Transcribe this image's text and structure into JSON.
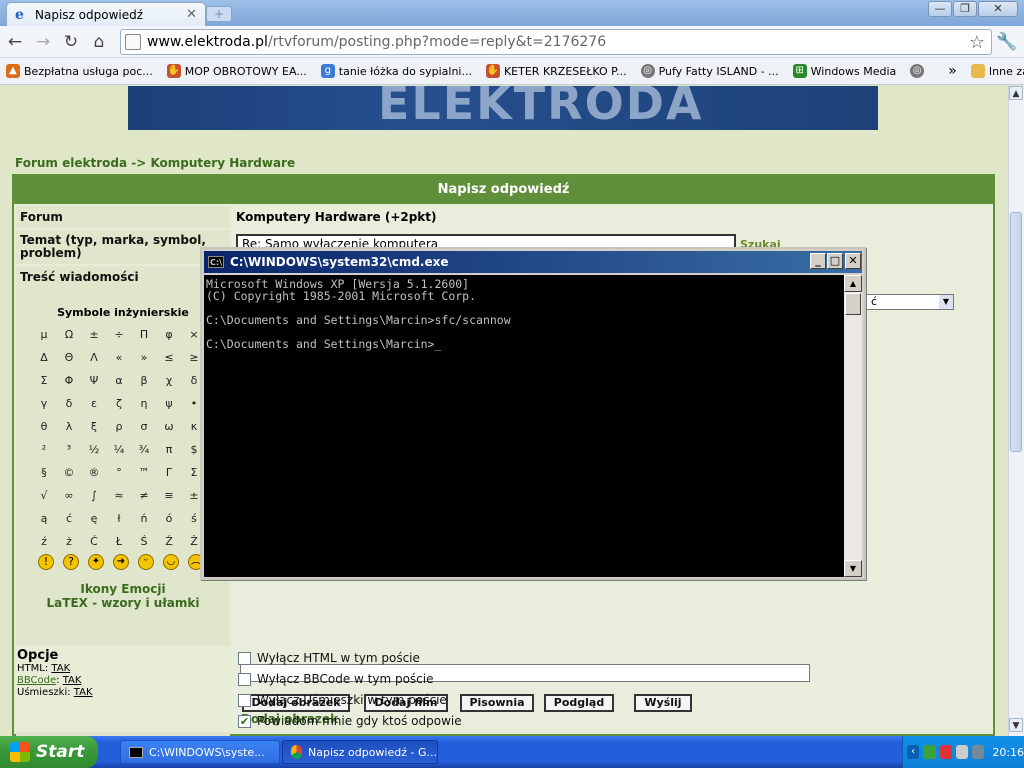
{
  "browser": {
    "tab_title": "Napisz odpowiedź",
    "url_host": "www.elektroda.pl",
    "url_path": "/rtvforum/posting.php?mode=reply&t=2176276",
    "bookmarks": [
      "Bezpłatna usługa poc...",
      "MOP OBROTOWY EA...",
      "tanie łóżka do sypialni...",
      "KETER KRZESEŁKO P...",
      "Pufy Fatty ISLAND - ...",
      "Windows Media"
    ],
    "bookmarks_more": "»",
    "other_bookmarks": "Inne zakładki"
  },
  "page": {
    "breadcrumb": "Forum elektroda -> Komputery Hardware",
    "form_header": "Napisz odpowiedź",
    "forum_label": "Forum",
    "forum_value": "Komputery Hardware (+2pkt)",
    "topic_label": "Temat (typ, marka, symbol, problem)",
    "topic_value": "Re: Samo wyłączenie komputera",
    "search_link": "Szukaj",
    "message_label": "Treść wiadomości",
    "symbols_title": "Symbole inżynierskie",
    "symbol_rows": [
      [
        "μ",
        "Ω",
        "±",
        "÷",
        "Π",
        "φ",
        "×"
      ],
      [
        "Δ",
        "Θ",
        "Λ",
        "«",
        "»",
        "≤",
        "≥"
      ],
      [
        "Σ",
        "Φ",
        "Ψ",
        "α",
        "β",
        "χ",
        "δ"
      ],
      [
        "γ",
        "δ",
        "ε",
        "ζ",
        "η",
        "ψ",
        "•"
      ],
      [
        "θ",
        "λ",
        "ξ",
        "ρ",
        "σ",
        "ω",
        "κ"
      ],
      [
        "²",
        "³",
        "½",
        "¼",
        "¾",
        "π",
        "$"
      ],
      [
        "§",
        "©",
        "®",
        "°",
        "™",
        "Γ",
        "Σ"
      ],
      [
        "√",
        "∞",
        "∫",
        "≈",
        "≠",
        "≡",
        "±"
      ],
      [
        "ą",
        "ć",
        "ę",
        "ł",
        "ń",
        "ó",
        "ś"
      ],
      [
        "ź",
        "ż",
        "Ć",
        "Ł",
        "Ś",
        "Ź",
        "Ż"
      ]
    ],
    "emoticons_link": "Ikony Emocji",
    "latex_link": "LaTEX - wzory i ułamki",
    "buttons": [
      "Dodaj obrazek",
      "Dodaj film",
      "Pisownia",
      "Podgląd",
      "Wyślij"
    ],
    "add_image_link": "Dodaj obrazek",
    "options_label": "Opcje",
    "html_label": "HTML:",
    "html_value": "TAK",
    "bbcode_label": "BBCode",
    "bbcode_value": "TAK",
    "smilies_label": "Uśmieszki:",
    "smilies_value": "TAK",
    "checkboxes": [
      {
        "label": "Wyłącz HTML w tym poście",
        "checked": false
      },
      {
        "label": "Wyłącz BBCode w tym poście",
        "checked": false
      },
      {
        "label": "Wyłącz Uśmieszki w tym poście",
        "checked": false
      },
      {
        "label": "Powiadom mnie gdy ktoś odpowie",
        "checked": true
      }
    ],
    "select_partial": "ć"
  },
  "cmd": {
    "title": "C:\\WINDOWS\\system32\\cmd.exe",
    "lines": [
      "Microsoft Windows XP [Wersja 5.1.2600]",
      "(C) Copyright 1985-2001 Microsoft Corp.",
      "",
      "C:\\Documents and Settings\\Marcin>sfc/scannow",
      "",
      "C:\\Documents and Settings\\Marcin>_"
    ]
  },
  "taskbar": {
    "start": "Start",
    "task1": "C:\\WINDOWS\\syste...",
    "task2": "Napisz odpowiedź - G...",
    "clock": "20:16"
  }
}
